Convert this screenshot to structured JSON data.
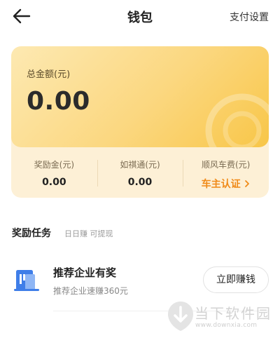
{
  "nav": {
    "title": "钱包",
    "right_label": "支付设置"
  },
  "balance": {
    "label": "总金额(元)",
    "value": "0.00"
  },
  "stats": {
    "reward": {
      "label": "奖励金(元)",
      "value": "0.00"
    },
    "ruqitong": {
      "label": "如祺通(元)",
      "value": "0.00"
    },
    "ride_fee": {
      "label": "顺风车费(元)",
      "link": "车主认证"
    }
  },
  "tasks": {
    "title": "奖励任务",
    "subtitle": "日日赚 可提现",
    "items": [
      {
        "title": "推荐企业有奖",
        "desc": "推荐企业速赚360元",
        "button": "立即赚钱"
      }
    ]
  },
  "watermark": {
    "name": "当下软件园",
    "url": "www.downxia.com"
  },
  "colors": {
    "accent": "#f08a18",
    "card_gold": "#f8c648",
    "task_icon": "#3f7ee8"
  }
}
